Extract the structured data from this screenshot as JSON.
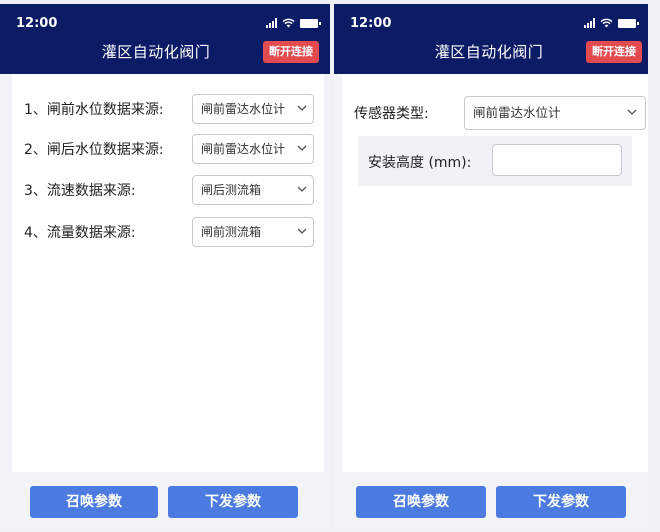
{
  "left": {
    "status_time": "12:00",
    "title": "灌区自动化阀门",
    "disconnect_label": "断开连接",
    "rows": [
      {
        "label": "1、闸前水位数据来源:",
        "value": "闸前雷达水位计"
      },
      {
        "label": "2、闸后水位数据来源:",
        "value": "闸前雷达水位计"
      },
      {
        "label": "3、流速数据来源:",
        "value": "闸后测流箱"
      },
      {
        "label": "4、流量数据来源:",
        "value": "闸前测流箱"
      }
    ],
    "recall_label": "召唤参数",
    "send_label": "下发参数"
  },
  "right": {
    "status_time": "12:00",
    "title": "灌区自动化阀门",
    "disconnect_label": "断开连接",
    "sensor_type_label": "传感器类型:",
    "sensor_type_value": "闸前雷达水位计",
    "install_height_label": "安装高度 (mm):",
    "install_height_value": "",
    "recall_label": "召唤参数",
    "send_label": "下发参数"
  },
  "colors": {
    "header_bg": "#0c1b66",
    "disconnect_bg": "#e24b50",
    "button_bg": "#4b7ae0"
  }
}
